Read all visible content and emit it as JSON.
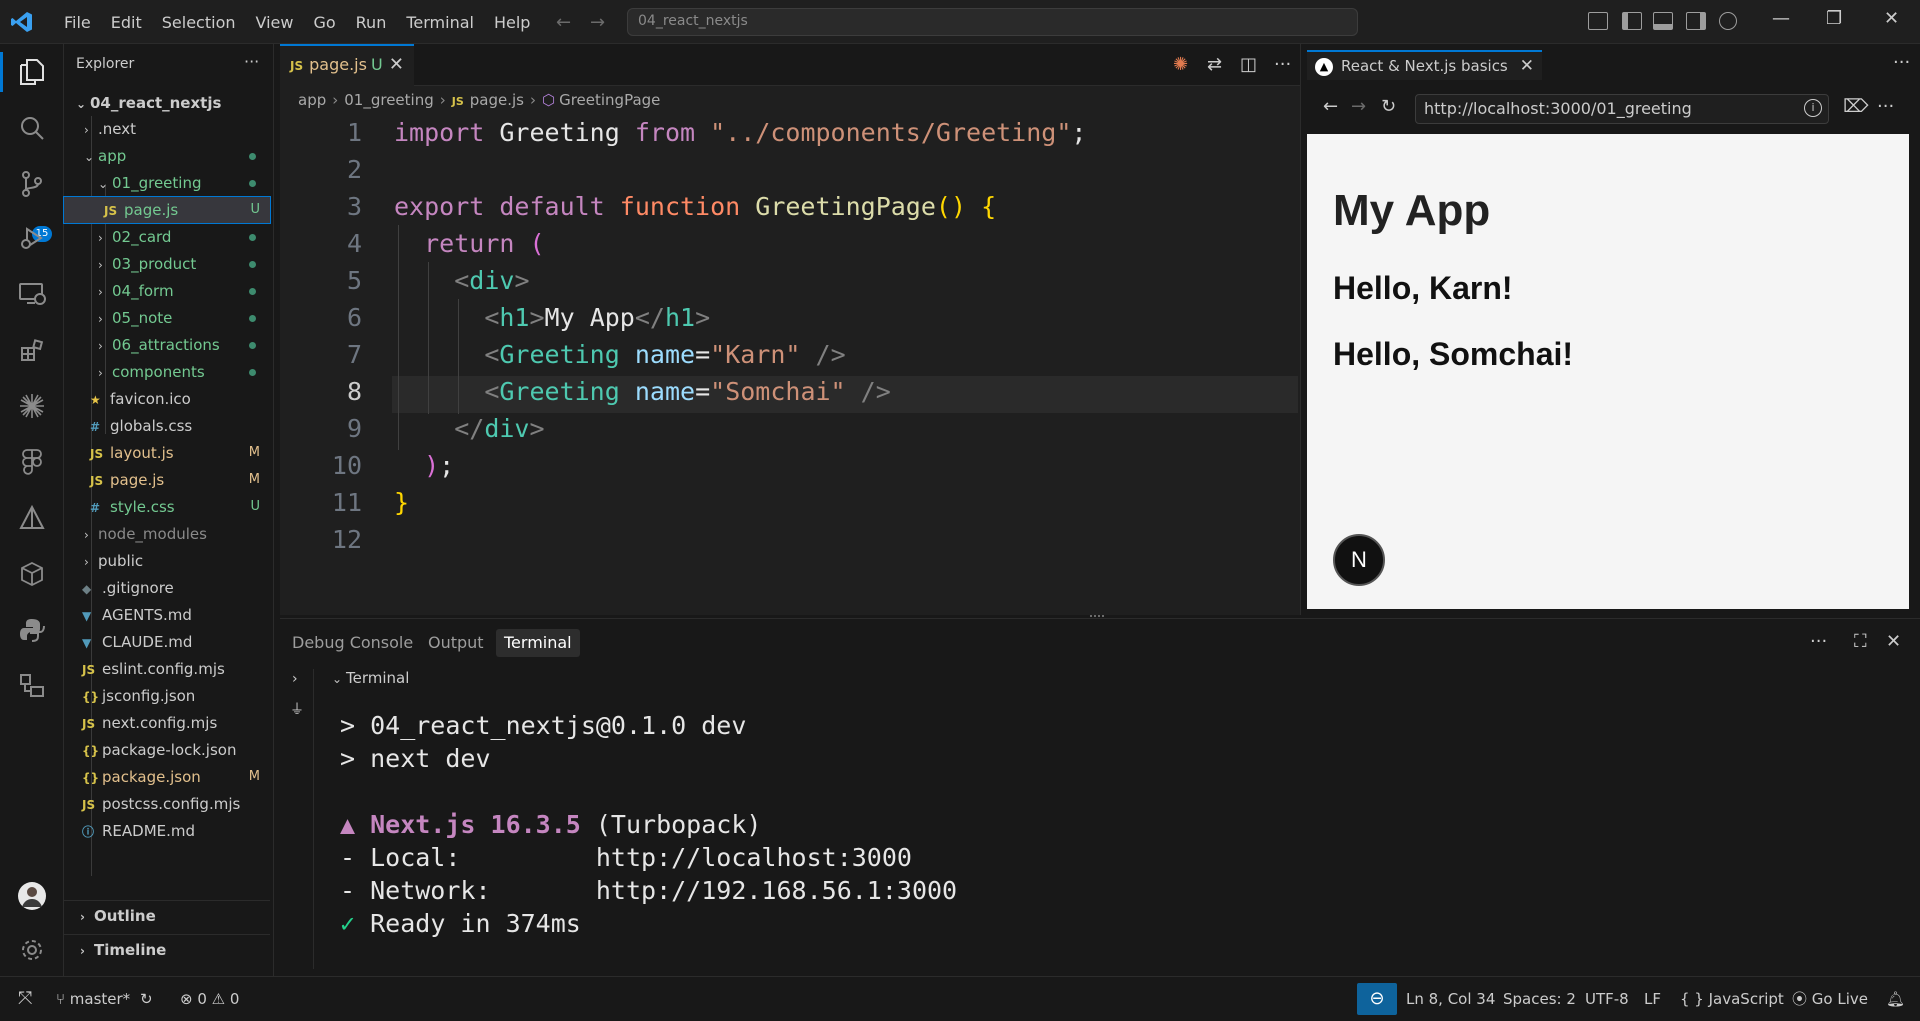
{
  "titlebar": {
    "menu": [
      "File",
      "Edit",
      "Selection",
      "View",
      "Go",
      "Run",
      "Terminal",
      "Help"
    ],
    "search": "04_react_nextjs"
  },
  "activity": {
    "scm_badge": "15"
  },
  "sidebar": {
    "title": "Explorer",
    "more": "···",
    "root": "04_react_nextjs",
    "items": [
      {
        "label": ".next",
        "status": ""
      },
      {
        "label": "app",
        "status": ""
      },
      {
        "label": "01_greeting",
        "status": ""
      },
      {
        "label": "page.js",
        "status": "U"
      },
      {
        "label": "02_card",
        "status": ""
      },
      {
        "label": "03_product",
        "status": ""
      },
      {
        "label": "04_form",
        "status": ""
      },
      {
        "label": "05_note",
        "status": ""
      },
      {
        "label": "06_attractions",
        "status": ""
      },
      {
        "label": "components",
        "status": ""
      },
      {
        "label": "favicon.ico",
        "status": ""
      },
      {
        "label": "globals.css",
        "status": ""
      },
      {
        "label": "layout.js",
        "status": "M"
      },
      {
        "label": "page.js",
        "status": "M"
      },
      {
        "label": "style.css",
        "status": "U"
      },
      {
        "label": "node_modules",
        "status": ""
      },
      {
        "label": "public",
        "status": ""
      },
      {
        "label": ".gitignore",
        "status": ""
      },
      {
        "label": "AGENTS.md",
        "status": ""
      },
      {
        "label": "CLAUDE.md",
        "status": ""
      },
      {
        "label": "eslint.config.mjs",
        "status": ""
      },
      {
        "label": "jsconfig.json",
        "status": ""
      },
      {
        "label": "next.config.mjs",
        "status": ""
      },
      {
        "label": "package-lock.json",
        "status": ""
      },
      {
        "label": "package.json",
        "status": "M"
      },
      {
        "label": "postcss.config.mjs",
        "status": ""
      },
      {
        "label": "README.md",
        "status": ""
      }
    ],
    "outline": "Outline",
    "timeline": "Timeline"
  },
  "editor": {
    "tab": {
      "label": "page.js",
      "status": "U",
      "type": "JS"
    },
    "breadcrumb": {
      "app": "app",
      "folder": "01_greeting",
      "file": "page.js",
      "symbol": "GreetingPage"
    },
    "line_numbers": [
      "1",
      "2",
      "3",
      "4",
      "5",
      "6",
      "7",
      "8",
      "9",
      "10",
      "11",
      "12"
    ],
    "current_line": "8",
    "code": {
      "l1": {
        "kw": "import",
        "name": "Greeting",
        "from": "from",
        "path": "\"../components/Greeting\"",
        "end": ";"
      },
      "l3": {
        "export": "export",
        "default": "default",
        "function": "function",
        "name": "GreetingPage",
        "parens": "()",
        "brace": "{"
      },
      "l4": {
        "ret": "return",
        "paren": "("
      },
      "l5": {
        "lt": "<",
        "tag": "div",
        "gt": ">"
      },
      "l6": {
        "lt": "<",
        "tag": "h1",
        "gt": ">",
        "text": "My App",
        "lt2": "</",
        "tag2": "h1",
        "gt2": ">"
      },
      "l7": {
        "lt": "<",
        "tag": "Greeting",
        "attr": "name",
        "eq": "=",
        "val": "\"Karn\"",
        "close": "/>"
      },
      "l8": {
        "lt": "<",
        "tag": "Greeting",
        "attr": "name",
        "eq": "=",
        "val": "\"Somchai\"",
        "close": "/>"
      },
      "l9": {
        "lt": "</",
        "tag": "div",
        "gt": ">"
      },
      "l10": {
        "paren": ")",
        "semi": ";"
      },
      "l11": {
        "brace": "}"
      }
    }
  },
  "browser": {
    "tab": "React & Next.js basics",
    "url": "http://localhost:3000/01_greeting",
    "page": {
      "h1": "My App",
      "greetings": [
        "Hello, Karn!",
        "Hello, Somchai!"
      ],
      "badge": "N"
    }
  },
  "panel": {
    "tabs": [
      "Debug Console",
      "Output",
      "Terminal"
    ],
    "terminal_title": "Terminal",
    "lines": {
      "l1": "> 04_react_nextjs@0.1.0 dev",
      "l2": "> next dev",
      "next_prefix": "▲ Next.js 16.3.5",
      "next_suffix": " (Turbopack)",
      "local": "- Local:         http://localhost:3000",
      "network": "- Network:       http://192.168.56.1:3000",
      "ready_mark": "✓",
      "ready": " Ready in 374ms"
    }
  },
  "status": {
    "branch": "master*",
    "errors": "0",
    "warnings": "0",
    "position": "Ln 8, Col 34",
    "spaces": "Spaces: 2",
    "encoding": "UTF-8",
    "eol": "LF",
    "language": "JavaScript",
    "golive": "Go Live"
  },
  "colors": {
    "accent": "#0078d4",
    "untracked": "#73c991",
    "modified": "#e2c08d"
  }
}
